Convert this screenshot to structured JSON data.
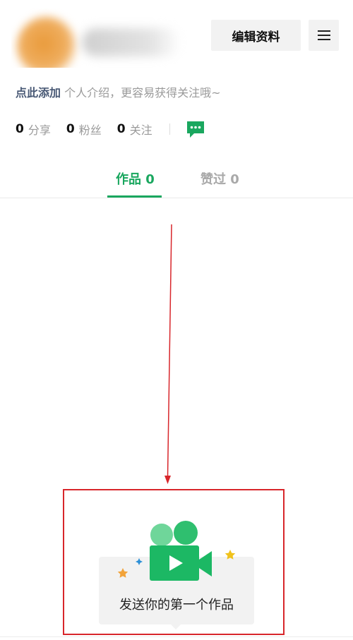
{
  "profile": {
    "edit_label": "编辑资料"
  },
  "bio": {
    "add_link": "点此添加",
    "hint": " 个人介绍，更容易获得关注哦~"
  },
  "stats": {
    "share_count": "0",
    "share_label": "分享",
    "fans_count": "0",
    "fans_label": "粉丝",
    "follow_count": "0",
    "follow_label": "关注"
  },
  "tabs": {
    "works_label": "作品 0",
    "liked_label": "赞过 0"
  },
  "empty_state": {
    "message": "发送你的第一个作品"
  },
  "colors": {
    "accent": "#1aa75f",
    "annotation": "#d8262b"
  },
  "icons": {
    "menu": "hamburger-menu-icon",
    "message": "message-bubble-icon",
    "camera": "video-camera-icon"
  }
}
